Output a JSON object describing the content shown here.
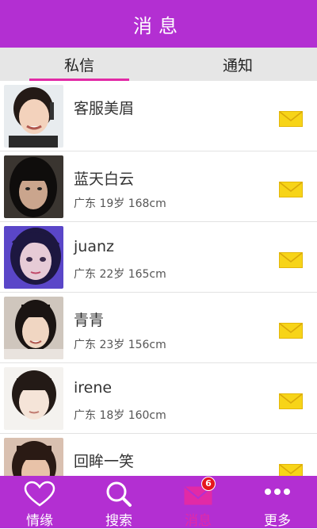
{
  "header": {
    "title": "消息"
  },
  "tabs": [
    {
      "label": "私信",
      "active": true
    },
    {
      "label": "通知",
      "active": false
    }
  ],
  "messages": [
    {
      "name": "客服美眉",
      "info": ""
    },
    {
      "name": "蓝天白云",
      "info": "广东 19岁 168cm"
    },
    {
      "name": "juanz",
      "info": "广东 22岁 165cm"
    },
    {
      "name": "青青",
      "info": "广东 23岁 156cm"
    },
    {
      "name": "irene",
      "info": "广东 18岁 160cm"
    },
    {
      "name": "回眸一笑",
      "info": ""
    }
  ],
  "tabbar": [
    {
      "label": "情缘",
      "icon": "heart-icon"
    },
    {
      "label": "搜索",
      "icon": "search-icon"
    },
    {
      "label": "消息",
      "icon": "mail-icon",
      "active": true,
      "badge": "6"
    },
    {
      "label": "更多",
      "icon": "more-icon"
    }
  ],
  "colors": {
    "brand": "#b32fd2",
    "accent": "#e22aa6",
    "badge": "#e5161d",
    "mail": "#f7d418"
  }
}
